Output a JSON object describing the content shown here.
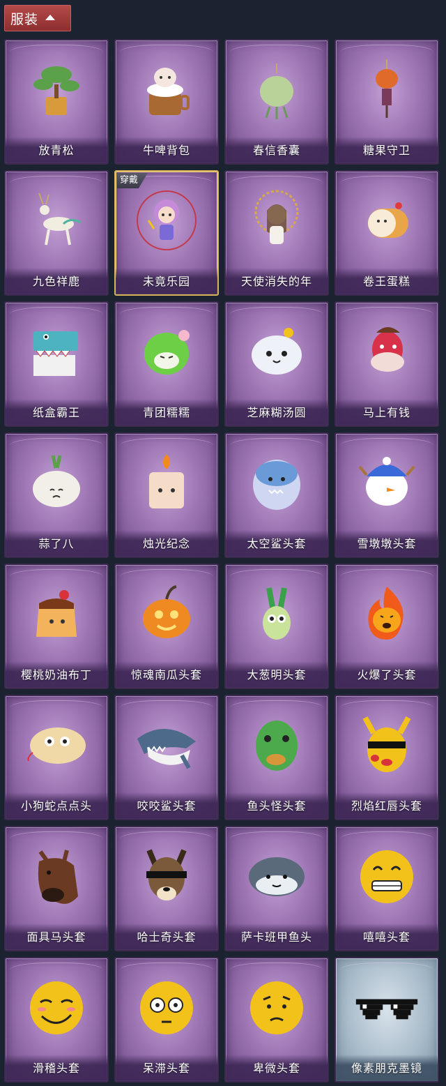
{
  "header": {
    "label": "服装"
  },
  "items": [
    {
      "name": "放青松",
      "icon": "bonsai-pine-icon",
      "color": "#5aa14a"
    },
    {
      "name": "牛啤背包",
      "icon": "cow-beer-barrel-icon",
      "color": "#c98a4a"
    },
    {
      "name": "春信香囊",
      "icon": "sachet-pouch-icon",
      "color": "#b9d29a"
    },
    {
      "name": "糖果守卫",
      "icon": "pumpkin-scarecrow-icon",
      "color": "#e06a2a"
    },
    {
      "name": "九色祥鹿",
      "icon": "deer-charm-icon",
      "color": "#f1ede0"
    },
    {
      "name": "未竟乐园",
      "icon": "clown-doll-icon",
      "color": "#c58ad8",
      "badge": "穿戴",
      "selected": true
    },
    {
      "name": "天使消失的年",
      "icon": "angel-girl-icon",
      "color": "#d8b58e"
    },
    {
      "name": "卷王蛋糕",
      "icon": "roll-cake-icon",
      "color": "#e9a54a"
    },
    {
      "name": "纸盒霸王",
      "icon": "box-dinosaur-icon",
      "color": "#4db3c0"
    },
    {
      "name": "青团糯糯",
      "icon": "green-dumpling-icon",
      "color": "#6ccf45"
    },
    {
      "name": "芝麻糊汤圆",
      "icon": "white-dumpling-icon",
      "color": "#eef1f8"
    },
    {
      "name": "马上有钱",
      "icon": "red-horse-icon",
      "color": "#d8324a"
    },
    {
      "name": "蒜了八",
      "icon": "garlic-icon",
      "color": "#f2efe8"
    },
    {
      "name": "烛光纪念",
      "icon": "candle-icon",
      "color": "#f4dcc8"
    },
    {
      "name": "太空鲨头套",
      "icon": "shark-egg-icon",
      "color": "#cfd6f2"
    },
    {
      "name": "雪墩墩头套",
      "icon": "snowman-icon",
      "color": "#ffffff"
    },
    {
      "name": "樱桃奶油布丁",
      "icon": "pudding-icon",
      "color": "#f3b35c"
    },
    {
      "name": "惊魂南瓜头套",
      "icon": "jack-o-lantern-icon",
      "color": "#ef8a23"
    },
    {
      "name": "大葱明头套",
      "icon": "scallion-icon",
      "color": "#c9e39a"
    },
    {
      "name": "火爆了头套",
      "icon": "fireball-icon",
      "color": "#f05a1a"
    },
    {
      "name": "小狗蛇点点头",
      "icon": "dog-snake-icon",
      "color": "#f0d9a6"
    },
    {
      "name": "咬咬鲨头套",
      "icon": "biting-shark-icon",
      "color": "#4d6a8a"
    },
    {
      "name": "鱼头怪头套",
      "icon": "fish-head-mask-icon",
      "color": "#4caa4c"
    },
    {
      "name": "烈焰红唇头套",
      "icon": "yellow-mask-sunglasses-icon",
      "color": "#f2c21a"
    },
    {
      "name": "面具马头套",
      "icon": "horse-mask-icon",
      "color": "#6a3a22"
    },
    {
      "name": "哈士奇头套",
      "icon": "husky-sunglasses-icon",
      "color": "#7a5a3a"
    },
    {
      "name": "萨卡班甲鱼头",
      "icon": "sacabambaspis-icon",
      "color": "#5a6a7a"
    },
    {
      "name": "嘻嘻头套",
      "icon": "grin-emoji-icon",
      "color": "#f2c21a"
    },
    {
      "name": "滑稽头套",
      "icon": "smirk-emoji-icon",
      "color": "#f2c21a"
    },
    {
      "name": "呆滞头套",
      "icon": "stare-emoji-icon",
      "color": "#f2c21a"
    },
    {
      "name": "卑微头套",
      "icon": "humble-emoji-icon",
      "color": "#f2c21a"
    },
    {
      "name": "像素朋克墨镜",
      "icon": "pixel-sunglasses-icon",
      "color": "#111111",
      "special": true
    }
  ]
}
